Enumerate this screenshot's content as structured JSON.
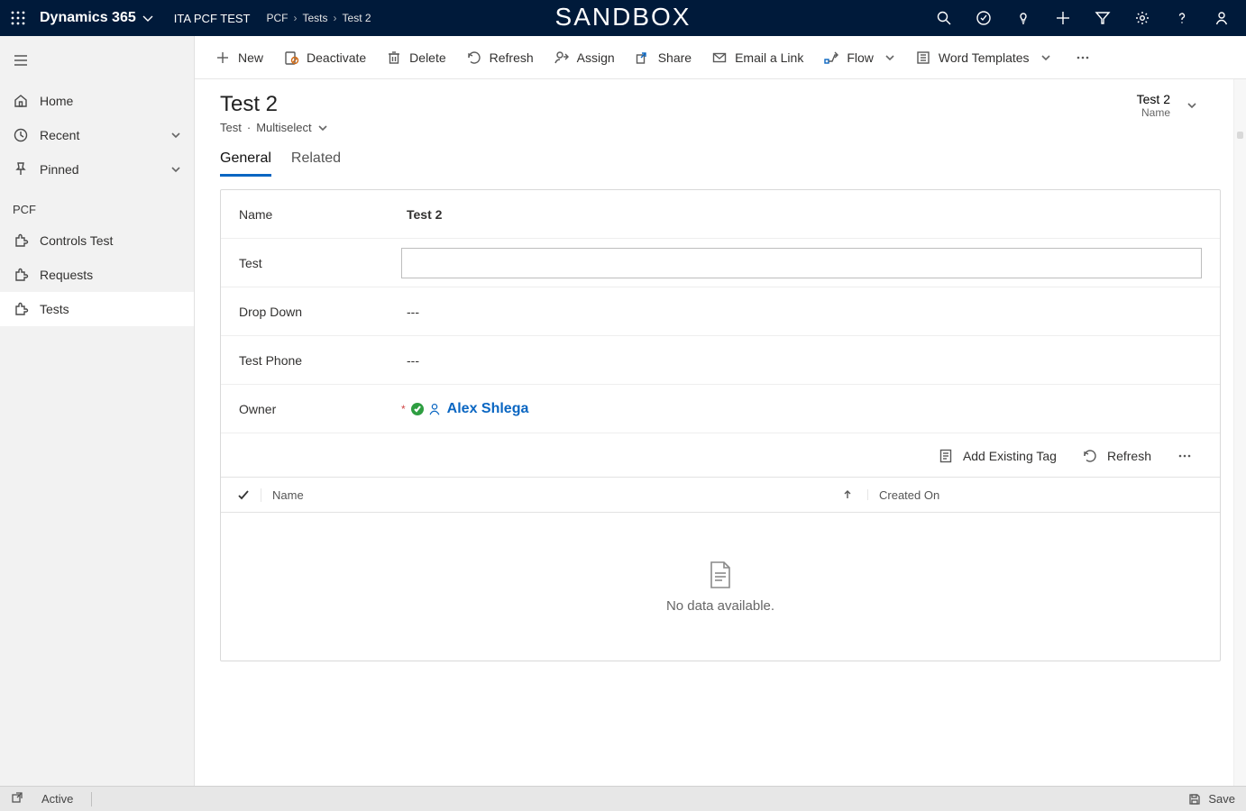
{
  "topbar": {
    "app_name": "Dynamics 365",
    "sub_app": "ITA PCF TEST",
    "center_title": "SANDBOX",
    "breadcrumbs": [
      "PCF",
      "Tests",
      "Test 2"
    ]
  },
  "sidebar": {
    "home": "Home",
    "recent": "Recent",
    "pinned": "Pinned",
    "section": "PCF",
    "items": [
      {
        "label": "Controls Test"
      },
      {
        "label": "Requests"
      },
      {
        "label": "Tests"
      }
    ]
  },
  "commands": {
    "new": "New",
    "deactivate": "Deactivate",
    "delete": "Delete",
    "refresh": "Refresh",
    "assign": "Assign",
    "share": "Share",
    "email": "Email a Link",
    "flow": "Flow",
    "word": "Word Templates"
  },
  "record": {
    "title": "Test 2",
    "entity": "Test",
    "form": "Multiselect",
    "card_value": "Test 2",
    "card_label": "Name"
  },
  "tabs": {
    "general": "General",
    "related": "Related"
  },
  "fields": {
    "name_label": "Name",
    "name_value": "Test 2",
    "test_label": "Test",
    "test_value": "",
    "dropdown_label": "Drop Down",
    "dropdown_value": "---",
    "phone_label": "Test Phone",
    "phone_value": "---",
    "owner_label": "Owner",
    "owner_value": "Alex Shlega",
    "required_marker": "*"
  },
  "subgrid": {
    "add": "Add Existing Tag",
    "refresh": "Refresh",
    "col_name": "Name",
    "col_created": "Created On",
    "empty": "No data available."
  },
  "status": {
    "state": "Active",
    "save": "Save"
  }
}
